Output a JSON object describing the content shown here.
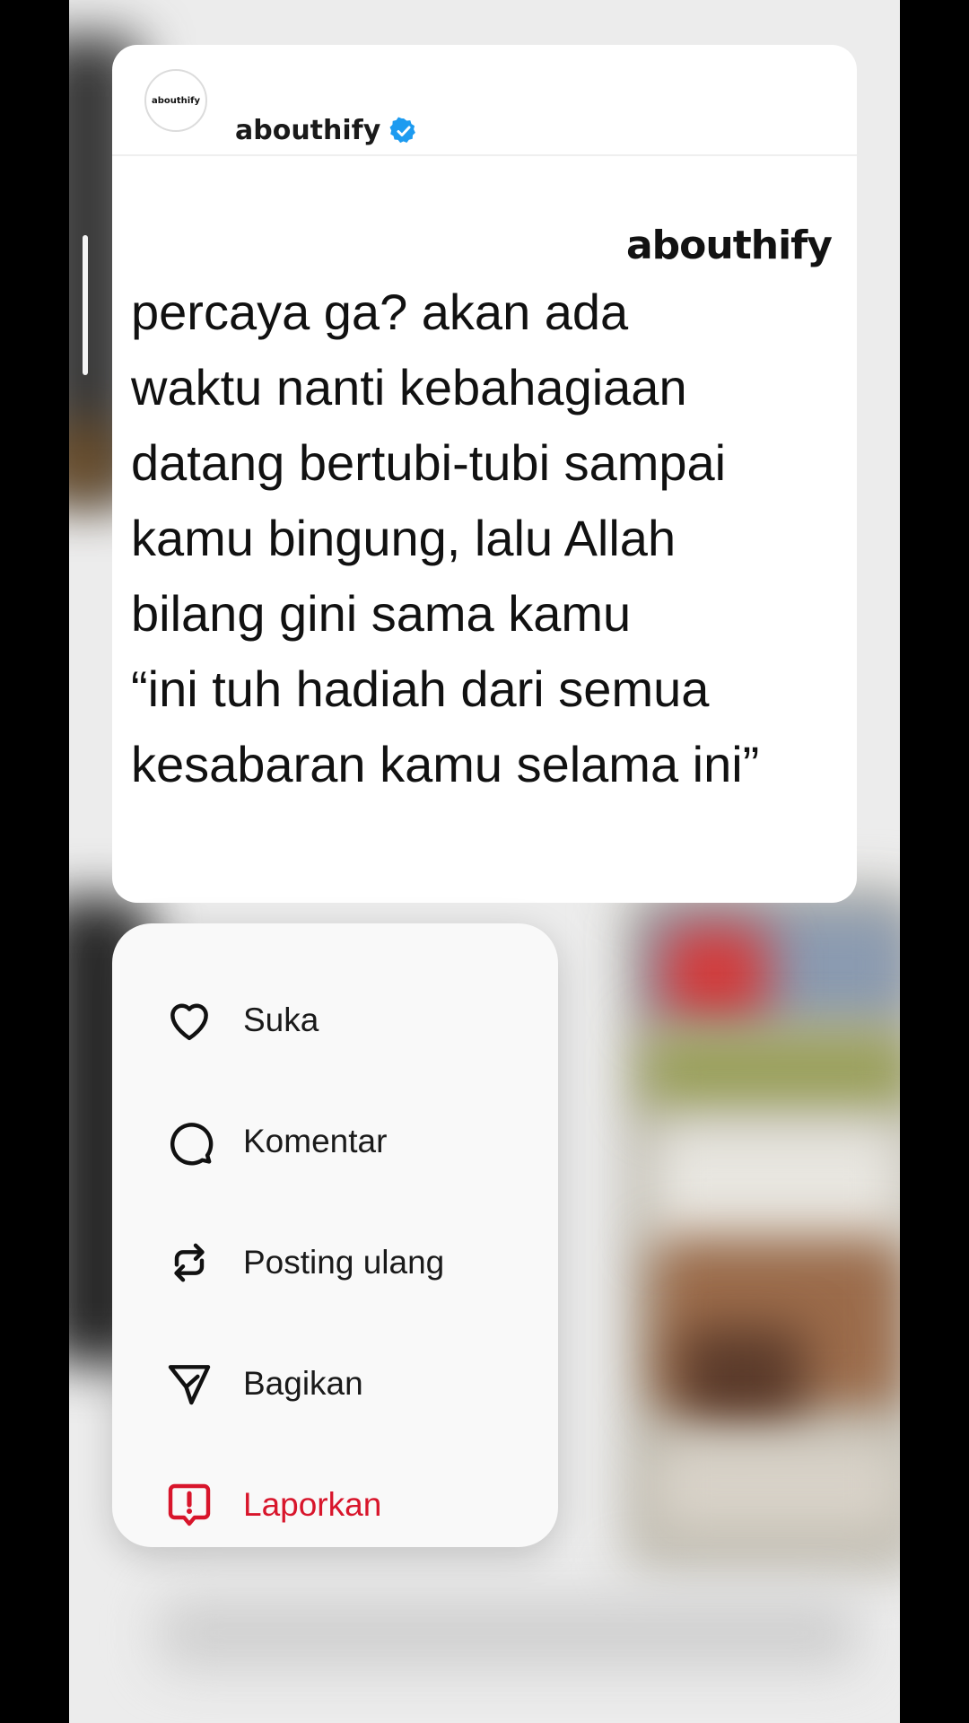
{
  "post": {
    "username": "abouthify",
    "avatar_text": "abouthify",
    "verified_icon": "verified-badge-icon",
    "brand_logo": "abouthify",
    "text_lines": [
      "percaya ga? akan ada",
      "waktu nanti kebahagiaan",
      "datang bertubi-tubi sampai",
      "kamu bingung, lalu Allah",
      "bilang gini sama kamu",
      "“ini tuh hadiah dari semua",
      "kesabaran kamu selama ini”"
    ]
  },
  "menu": {
    "items": [
      {
        "label": "Suka",
        "icon": "heart-icon"
      },
      {
        "label": "Komentar",
        "icon": "comment-icon"
      },
      {
        "label": "Posting ulang",
        "icon": "repost-icon"
      },
      {
        "label": "Bagikan",
        "icon": "share-icon"
      },
      {
        "label": "Laporkan",
        "icon": "report-icon"
      }
    ]
  },
  "colors": {
    "verified": "#1d9bf0",
    "danger": "#d8152b",
    "text": "#111111"
  }
}
